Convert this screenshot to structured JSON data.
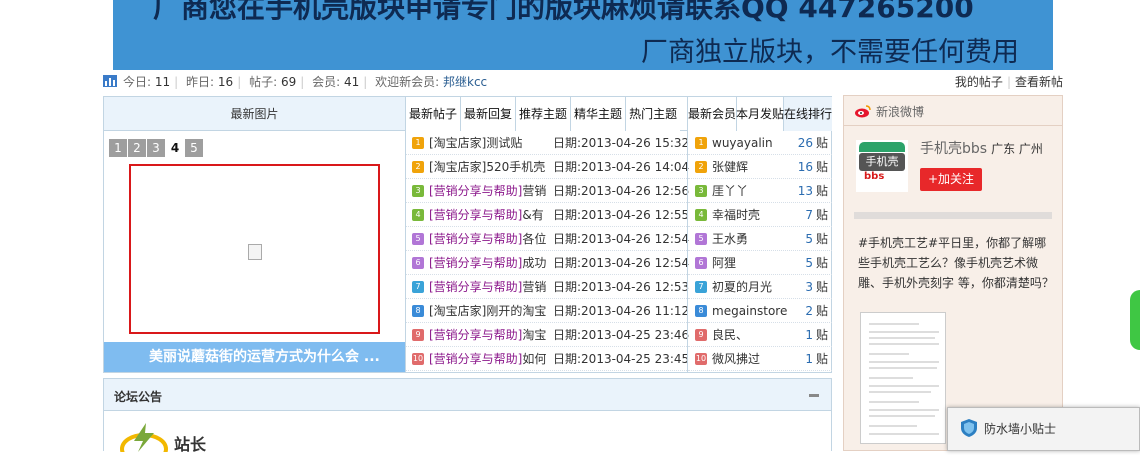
{
  "banner": {
    "line1": "厂商您在手机壳版块申请专门的版块麻烦请联系QQ  447265200",
    "line2": "厂商独立版块，不需要任何费用"
  },
  "stats": {
    "today_label": "今日:",
    "today": "11",
    "yesterday_label": "昨日:",
    "yesterday": "16",
    "posts_label": "帖子:",
    "posts": "69",
    "members_label": "会员:",
    "members": "41",
    "welcome_label": "欢迎新会员:",
    "new_member": "邦继kcc",
    "my_posts": "我的帖子",
    "view_new": "查看新帖"
  },
  "pictures": {
    "header": "最新图片",
    "pages": [
      "1",
      "2",
      "3",
      "4",
      "5"
    ],
    "active_page": "4",
    "caption": "美丽说蘑菇街的运营方式为什么会 ..."
  },
  "thread_tabs": [
    "最新帖子",
    "最新回复",
    "推荐主题",
    "精华主题",
    "热门主题"
  ],
  "threads": [
    {
      "num": "1",
      "cat": "[淘宝店家]",
      "title": "测试贴",
      "date": "日期:2013-04-26 15:32"
    },
    {
      "num": "2",
      "cat": "[淘宝店家]",
      "title": "520手机壳",
      "date": "日期:2013-04-26 14:04"
    },
    {
      "num": "3",
      "cat": "[营销分享与帮助]",
      "title": "营销",
      "date": "日期:2013-04-26 12:56"
    },
    {
      "num": "4",
      "cat": "[营销分享与帮助]",
      "title": "&有",
      "date": "日期:2013-04-26 12:55"
    },
    {
      "num": "5",
      "cat": "[营销分享与帮助]",
      "title": "各位",
      "date": "日期:2013-04-26 12:54"
    },
    {
      "num": "6",
      "cat": "[营销分享与帮助]",
      "title": "成功",
      "date": "日期:2013-04-26 12:54"
    },
    {
      "num": "7",
      "cat": "[营销分享与帮助]",
      "title": "营销",
      "date": "日期:2013-04-26 12:53"
    },
    {
      "num": "8",
      "cat": "[淘宝店家]",
      "title": "刚开的淘宝",
      "date": "日期:2013-04-26 11:12"
    },
    {
      "num": "9",
      "cat": "[营销分享与帮助]",
      "title": "淘宝",
      "date": "日期:2013-04-25 23:46"
    },
    {
      "num": "10",
      "cat": "[营销分享与帮助]",
      "title": "如何",
      "date": "日期:2013-04-25 23:45"
    }
  ],
  "member_tabs": [
    "最新会员",
    "本月发贴",
    "在线排行"
  ],
  "members": [
    {
      "num": "1",
      "name": "wuyayalin",
      "count": "26",
      "unit": "贴"
    },
    {
      "num": "2",
      "name": "张健辉",
      "count": "16",
      "unit": "贴"
    },
    {
      "num": "3",
      "name": "厓丫丫",
      "count": "13",
      "unit": "贴"
    },
    {
      "num": "4",
      "name": "幸福时壳",
      "count": "7",
      "unit": "贴"
    },
    {
      "num": "5",
      "name": "王水勇",
      "count": "5",
      "unit": "贴"
    },
    {
      "num": "6",
      "name": "阿狸",
      "count": "5",
      "unit": "贴"
    },
    {
      "num": "7",
      "name": "初夏的月光",
      "count": "3",
      "unit": "贴"
    },
    {
      "num": "8",
      "name": "megainstore",
      "count": "2",
      "unit": "贴"
    },
    {
      "num": "9",
      "name": "良民、",
      "count": "1",
      "unit": "贴"
    },
    {
      "num": "10",
      "name": "微风拂过",
      "count": "1",
      "unit": "贴"
    }
  ],
  "weibo": {
    "header": "新浪微博",
    "logo_text": "手机壳",
    "logo_sub": "bbs",
    "user": "手机壳bbs",
    "location": "广东 广州",
    "follow": "+加关注",
    "post": "#手机壳工艺#平日里，你都了解哪些手机壳工艺么？像手机壳艺术微雕、手机外壳刻字 等，你都清楚吗？"
  },
  "notice": {
    "header": "论坛公告",
    "logo_text": "站长"
  },
  "popup": {
    "title": "防水墙小贴士"
  },
  "colors": {
    "banner": "#3f93d3",
    "border": "#c2d5e3",
    "follow": "#e8282a",
    "accent_link": "#2b6cb0"
  }
}
